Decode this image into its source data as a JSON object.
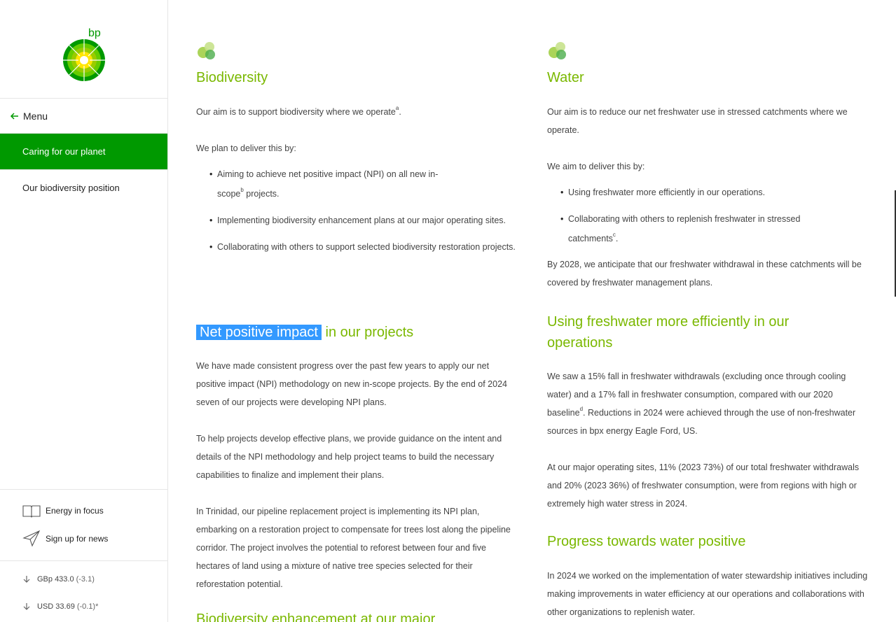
{
  "sidebar": {
    "logo_text": "bp",
    "menu_label": "Menu",
    "nav_active": "Caring for our planet",
    "nav_item": "Our biodiversity position",
    "utilities": [
      {
        "label": "Energy in focus",
        "icon": "book-icon"
      },
      {
        "label": "Sign up for news",
        "icon": "paper-plane-icon"
      }
    ],
    "share_prices": [
      {
        "label": "GBp 433.0",
        "change": "(-3.1)"
      },
      {
        "label": "USD 33.69",
        "change": "(-0.1)*"
      }
    ]
  },
  "colA": {
    "title": "Biodiversity",
    "p1_main": "Our aim is to support biodiversity where we operate",
    "p1_sup": "a",
    "p1_end": ".",
    "p2": "We plan to deliver this by:",
    "bullets": [
      {
        "text": "Aiming to achieve net positive impact (NPI) on all new in-scope",
        "sup": "b",
        "end": " projects."
      },
      {
        "text": "Implementing biodiversity enhancement plans at our major operating sites."
      },
      {
        "text": "Collaborating with others to support selected biodiversity restoration projects."
      }
    ],
    "h_npi_highlight": "Net positive impact",
    "h_npi_rest": " in our projects",
    "npi_p1": "We have made consistent progress over the past few years to apply our net positive impact (NPI) methodology on new in-scope projects. By the end of 2024 seven of our projects were developing NPI plans.",
    "npi_p2": "To help projects develop effective plans, we provide guidance on the intent and details of the NPI methodology and help project teams to build the necessary capabilities to finalize and implement their plans.",
    "npi_p3": "In Trinidad, our pipeline replacement project is implementing its NPI plan, embarking on a restoration project to compensate for trees lost along the pipeline corridor. The project involves the potential to reforest between four and five hectares of land using a mixture of native tree species selected for their reforestation potential.",
    "h_enh": "Biodiversity enhancement at our major"
  },
  "colB": {
    "title": "Water",
    "p1": "Our aim is to reduce our net freshwater use in stressed catchments where we operate.",
    "p2": "We aim to deliver this by:",
    "bullets": [
      {
        "text": "Using freshwater more efficiently in our operations."
      },
      {
        "text": "Collaborating with others to replenish freshwater in stressed catchments",
        "sup": "c",
        "end": "."
      }
    ],
    "p3": "By 2028, we anticipate that our freshwater withdrawal in these catchments will be covered by freshwater management plans.",
    "h_eff": "Using freshwater more efficiently in our operations",
    "eff_p1_main": "We saw a 15% fall in freshwater withdrawals (excluding once through cooling water) and a 17% fall in freshwater consumption, compared with our 2020 baseline",
    "eff_p1_sup": "d",
    "eff_p1_end": ". Reductions in 2024 were achieved through the use of non-freshwater sources in bpx energy Eagle Ford, US.",
    "eff_p2": "At our major operating sites, 11% (2023 73%) of our total freshwater withdrawals and 20% (2023 36%) of freshwater consumption, were from regions with high or extremely high water stress in 2024.",
    "h_prog": "Progress towards water positive",
    "prog_p1": "In 2024 we worked on the implementation of water stewardship initiatives including making improvements in water efficiency at our operations and collaborations with other organizations to replenish water."
  }
}
